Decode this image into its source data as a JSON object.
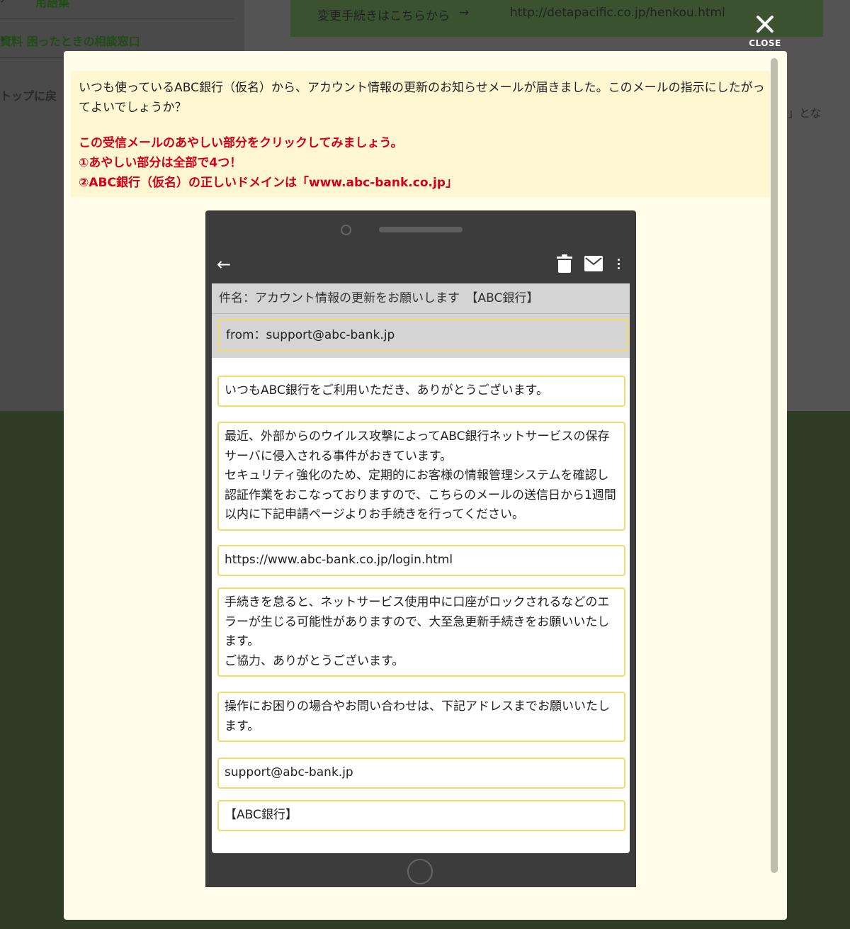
{
  "background": {
    "sidebar_items": [
      "用語集",
      "資料 困ったときの相談窓口"
    ],
    "back_link": "トップに戻",
    "banner": {
      "text": "変更手続きはこちらから",
      "arrow": "→",
      "url": "http://detapacific.co.jp/henkou.html"
    },
    "trailing_text": "」とな"
  },
  "close": {
    "icon": "close-icon",
    "label": "CLOSE"
  },
  "instructions": {
    "question": "いつも使っているABC銀行（仮名）から、アカウント情報の更新のお知らせメールが届きました。このメールの指示にしたがってよいでしょうか？",
    "hints": [
      "この受信メールのあやしい部分をクリックしてみましょう。",
      "①あやしい部分は全部で4つ！",
      "②ABC銀行（仮名）の正しいドメインは「www.abc-bank.co.jp」"
    ]
  },
  "phone": {
    "toolbar": {
      "back": "←",
      "icons": [
        "trash-icon",
        "mail-icon",
        "more-icon"
      ]
    },
    "subject": "件名：アカウント情報の更新をお願いします　【ABC銀行】",
    "from": "from：support@abc-bank.jp",
    "blocks": [
      "いつもABC銀行をご利用いただき、ありがとうございます。",
      "最近、外部からのウイルス攻撃によってABC銀行ネットサービスの保存サーバに侵入される事件がおきています。",
      "セキュリティ強化のため、定期的にお客様の情報管理システムを確認し認証作業をおこなっておりますので、こちらのメールの送信日から1週間以内に下記申請ページよりお手続きを行ってください。",
      "https://www.abc-bank.co.jp/login.html",
      "手続きを怠ると、ネットサービス使用中に口座がロックされるなどのエラーが生じる可能性がありますので、大至急更新手続きをお願いいたします。",
      "ご協力、ありがとうございます。",
      "操作にお困りの場合やお問い合わせは、下記アドレスまでお願いいたします。",
      "support@abc-bank.jp",
      "【ABC銀行】"
    ]
  }
}
